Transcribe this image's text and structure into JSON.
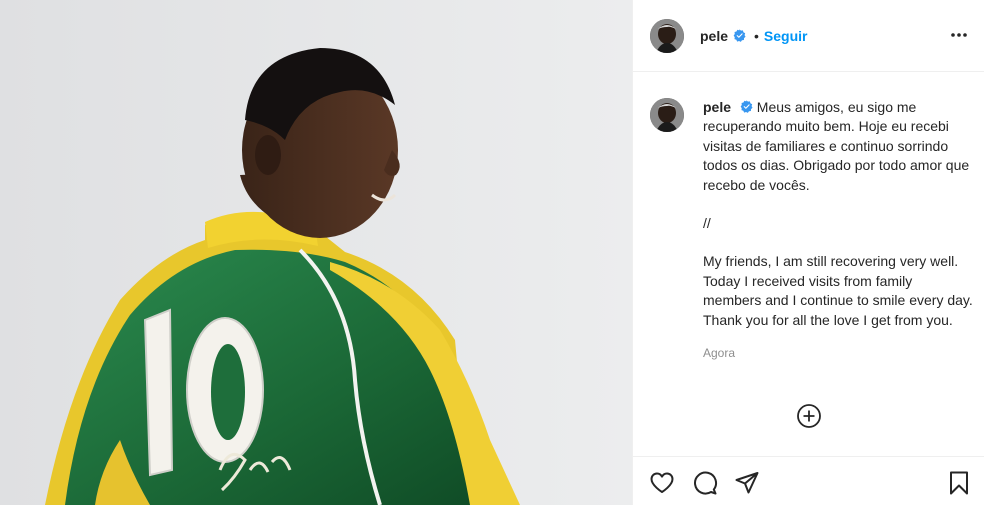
{
  "post": {
    "photo": {
      "subject": "Pelé in green and yellow number 10 jersey"
    },
    "header": {
      "username": "pele",
      "verified": true,
      "separator": "•",
      "follow_label": "Seguir"
    },
    "caption": {
      "username": "pele",
      "paragraph_pt": "Meus amigos, eu sigo me recuperando muito bem. Hoje eu recebi visitas de familiares e continuo sorrindo todos os dias. Obrigado por todo amor que recebo de vocês.",
      "divider": "//",
      "paragraph_en": "My friends, I am still recovering very well. Today I received visits from family members and I continue to smile every day. Thank you for all the love I get from you.",
      "timestamp": "Agora"
    },
    "actions": {
      "icons": [
        "heart-icon",
        "comment-icon",
        "share-icon",
        "bookmark-icon"
      ],
      "more_comments_icon": "plus-circle-icon"
    },
    "colors": {
      "link": "#0095f6",
      "text": "#262626",
      "muted": "#8e8e8e",
      "border": "#efefef",
      "jersey_green": "#1d6b3a",
      "jersey_yellow": "#f2d230"
    }
  }
}
